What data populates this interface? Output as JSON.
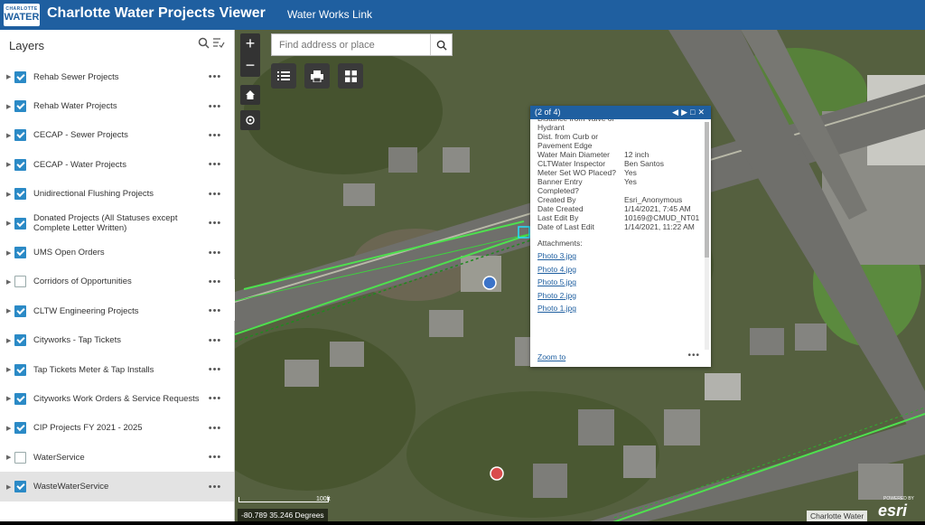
{
  "header": {
    "logo_line1": "CHARLOTTE",
    "logo_line2": "WATER",
    "title": "Charlotte Water Projects Viewer",
    "link": "Water Works Link"
  },
  "sidebar": {
    "title": "Layers",
    "layers": [
      {
        "label": "Rehab Sewer Projects",
        "checked": true
      },
      {
        "label": "Rehab Water Projects",
        "checked": true
      },
      {
        "label": "CECAP - Sewer Projects",
        "checked": true
      },
      {
        "label": "CECAP - Water Projects",
        "checked": true
      },
      {
        "label": "Unidirectional Flushing Projects",
        "checked": true
      },
      {
        "label": "Donated Projects (All Statuses except Complete Letter Written)",
        "checked": true
      },
      {
        "label": "UMS Open Orders",
        "checked": true
      },
      {
        "label": "Corridors of Opportunities",
        "checked": false
      },
      {
        "label": "CLTW Engineering Projects",
        "checked": true
      },
      {
        "label": "Cityworks - Tap Tickets",
        "checked": true
      },
      {
        "label": "Tap Tickets Meter & Tap Installs",
        "checked": true
      },
      {
        "label": "Cityworks Work Orders & Service Requests",
        "checked": true
      },
      {
        "label": "CIP Projects FY 2021 - 2025",
        "checked": true
      },
      {
        "label": "WaterService",
        "checked": false
      },
      {
        "label": "WasteWaterService",
        "checked": true,
        "selected": true
      }
    ]
  },
  "search": {
    "placeholder": "Find address or place"
  },
  "popup": {
    "counter": "(2 of 4)",
    "partial_label": "Distance from Valve or Hydrant",
    "rows": [
      {
        "k": "Dist. from Curb or Pavement Edge",
        "v": ""
      },
      {
        "k": "Water Main Diameter",
        "v": "12 inch"
      },
      {
        "k": "CLTWater Inspector",
        "v": "Ben Santos"
      },
      {
        "k": "Meter Set WO Placed?",
        "v": "Yes"
      },
      {
        "k": "Banner Entry Completed?",
        "v": "Yes"
      },
      {
        "k": "Created By",
        "v": "Esri_Anonymous"
      },
      {
        "k": "Date Created",
        "v": "1/14/2021, 7:45 AM"
      },
      {
        "k": "Last Edit By",
        "v": "10169@CMUD_NT01"
      },
      {
        "k": "Date of Last Edit",
        "v": "1/14/2021, 11:22 AM"
      }
    ],
    "attachments_label": "Attachments:",
    "attachments": [
      "Photo 3.jpg",
      "Photo 4.jpg",
      "Photo 5.jpg",
      "Photo 2.jpg",
      "Photo 1.jpg"
    ],
    "zoom_to": "Zoom to"
  },
  "map": {
    "coords": "-80.789 35.246 Degrees",
    "scale_label": "100ft",
    "attribution": "Charlotte Water",
    "esri_powered": "POWERED BY",
    "esri": "esri"
  },
  "colors": {
    "header": "#1f5fa0",
    "checkbox": "#2b8ac6",
    "pipe": "#4ee04e"
  }
}
